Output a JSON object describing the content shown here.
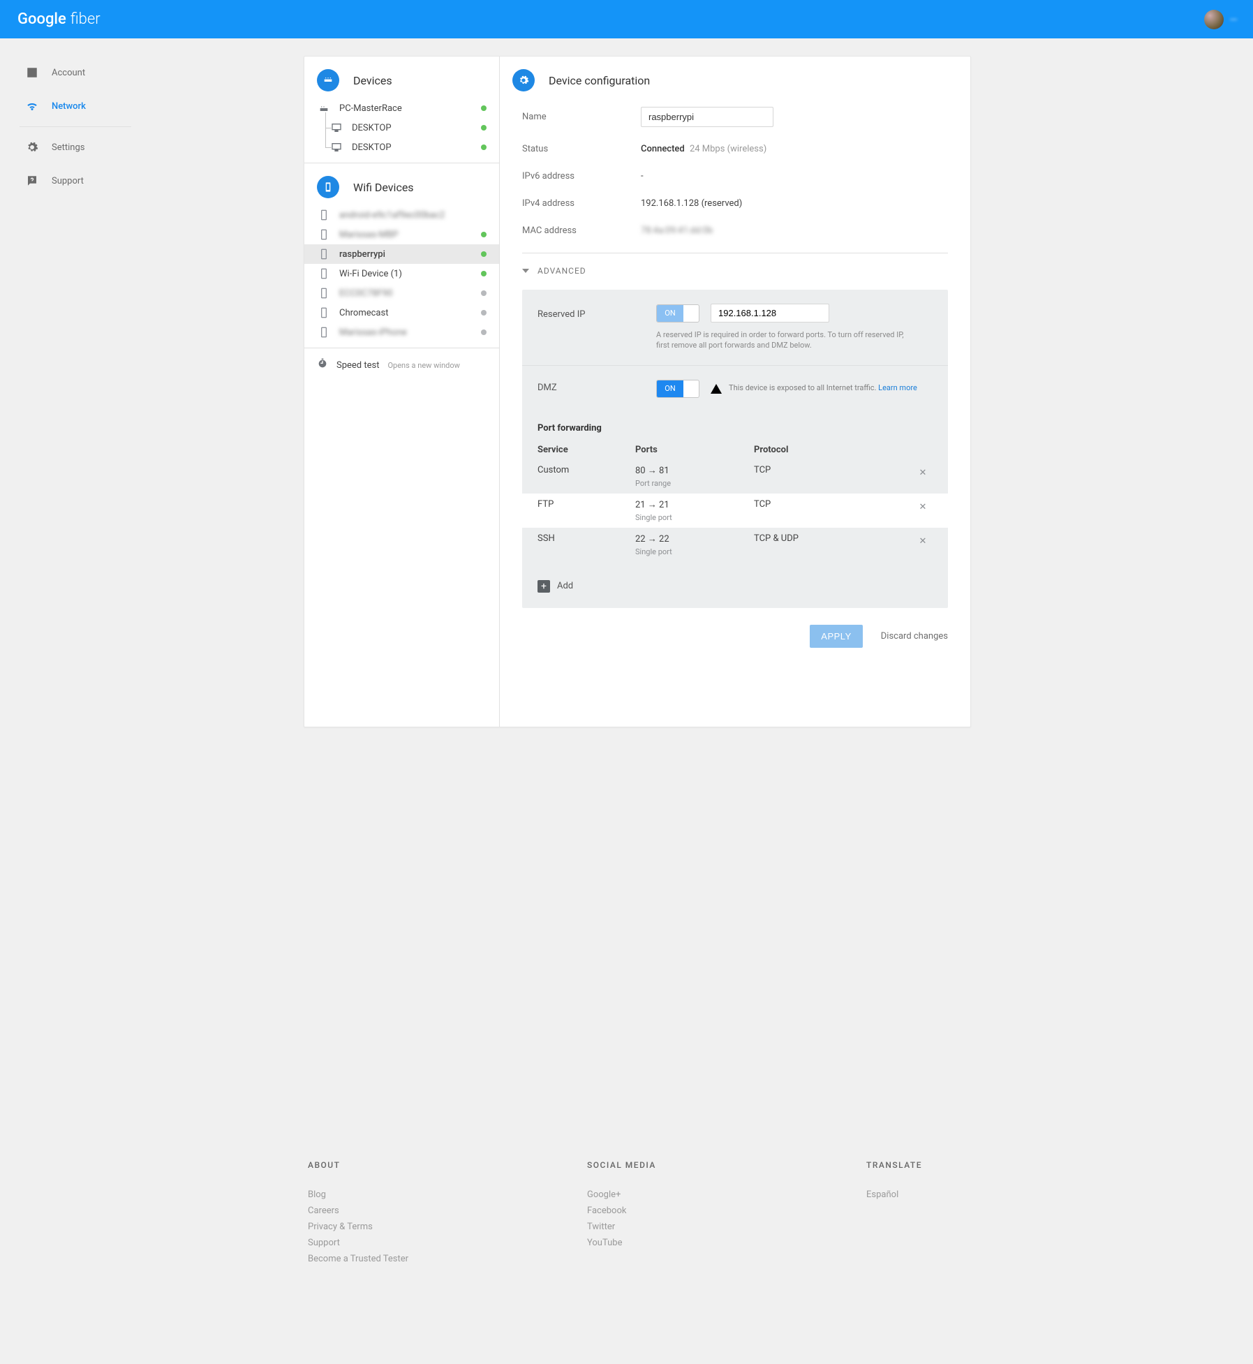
{
  "header": {
    "brand_a": "Google",
    "brand_b": "fiber",
    "user_blur": "—"
  },
  "nav": {
    "account": "Account",
    "network": "Network",
    "settings": "Settings",
    "support": "Support"
  },
  "devices": {
    "title": "Devices",
    "items": [
      {
        "label": "PC-MasterRace",
        "type": "router",
        "dot": "green"
      },
      {
        "label": "DESKTOP",
        "type": "monitor",
        "dot": "green",
        "child": 1
      },
      {
        "label": "DESKTOP",
        "type": "monitor",
        "dot": "green",
        "child": 1,
        "last": true
      }
    ]
  },
  "wifi": {
    "title": "Wifi Devices",
    "items": [
      {
        "label": "android-e9c1af9ec00bac2",
        "dot": "",
        "blur": true
      },
      {
        "label": "Marissas-MBP",
        "dot": "green",
        "blur": true
      },
      {
        "label": "raspberrypi",
        "dot": "green",
        "selected": true
      },
      {
        "label": "Wi-Fi Device (1)",
        "dot": "green"
      },
      {
        "label": "ECC0C78F90",
        "dot": "grey",
        "blur": true
      },
      {
        "label": "Chromecast",
        "dot": "grey"
      },
      {
        "label": "Marissas-iPhone",
        "dot": "grey",
        "blur": true
      }
    ]
  },
  "speedtest": {
    "label": "Speed test",
    "note": "Opens a new window"
  },
  "config": {
    "title": "Device configuration",
    "name_label": "Name",
    "name_value": "raspberrypi",
    "status_label": "Status",
    "status_value": "Connected",
    "status_detail": "24 Mbps (wireless)",
    "ipv6_label": "IPv6 address",
    "ipv6_value": "-",
    "ipv4_label": "IPv4 address",
    "ipv4_value": "192.168.1.128 (reserved)",
    "mac_label": "MAC address",
    "mac_value": "78:4a:09:41:dd:0b",
    "advanced_label": "ADVANCED",
    "reserved_label": "Reserved IP",
    "reserved_on": "ON",
    "reserved_ip": "192.168.1.128",
    "reserved_hint": "A reserved IP is required in order to forward ports. To turn off reserved IP, first remove all port forwards and DMZ below.",
    "dmz_label": "DMZ",
    "dmz_on": "ON",
    "dmz_msg": "This device is exposed to all Internet traffic.",
    "dmz_learn": "Learn more",
    "pf_title": "Port forwarding",
    "pf_head": {
      "service": "Service",
      "ports": "Ports",
      "protocol": "Protocol"
    },
    "pf_rows": [
      {
        "service": "Custom",
        "ports": "80 → 81",
        "sub": "Port range",
        "protocol": "TCP"
      },
      {
        "service": "FTP",
        "ports": "21 → 21",
        "sub": "Single port",
        "protocol": "TCP"
      },
      {
        "service": "SSH",
        "ports": "22 → 22",
        "sub": "Single port",
        "protocol": "TCP & UDP"
      }
    ],
    "add_label": "Add",
    "apply": "APPLY",
    "discard": "Discard changes"
  },
  "footer": {
    "about": {
      "hd": "ABOUT",
      "links": [
        "Blog",
        "Careers",
        "Privacy & Terms",
        "Support",
        "Become a Trusted Tester"
      ]
    },
    "social": {
      "hd": "SOCIAL MEDIA",
      "links": [
        "Google+",
        "Facebook",
        "Twitter",
        "YouTube"
      ]
    },
    "translate": {
      "hd": "TRANSLATE",
      "links": [
        "Español"
      ]
    }
  }
}
